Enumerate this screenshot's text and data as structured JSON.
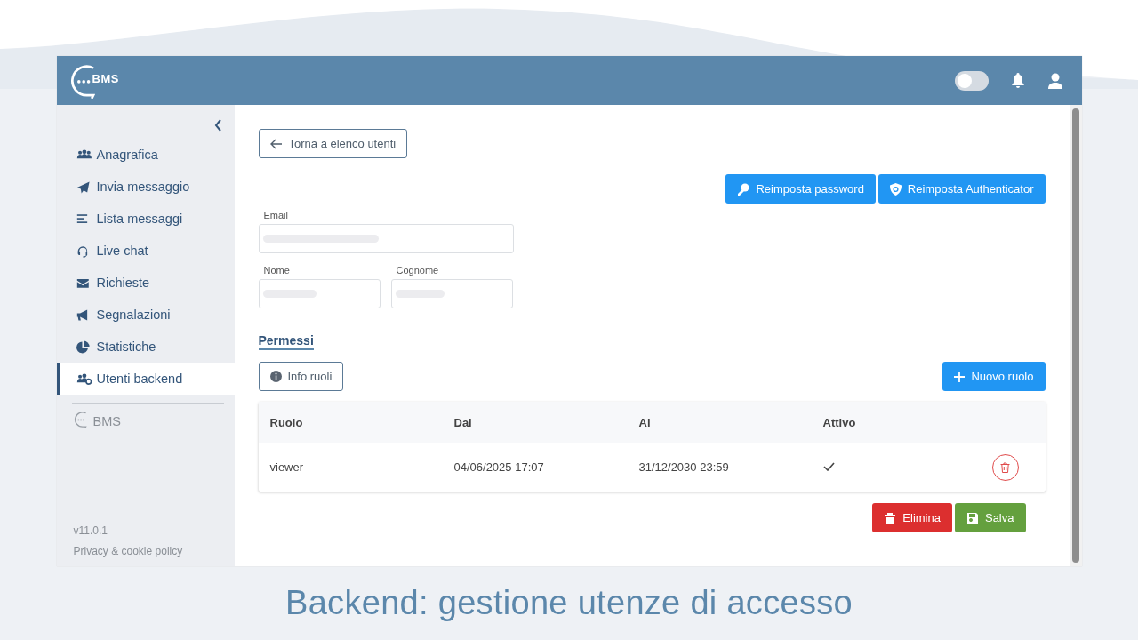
{
  "header": {
    "logo_text": "BMS",
    "dark_mode": {
      "on": false
    }
  },
  "sidebar": {
    "items": [
      {
        "label": "Anagrafica",
        "selected": false
      },
      {
        "label": "Invia messaggio",
        "selected": false
      },
      {
        "label": "Lista messaggi",
        "selected": false
      },
      {
        "label": "Live chat",
        "selected": false
      },
      {
        "label": "Richieste",
        "selected": false
      },
      {
        "label": "Segnalazioni",
        "selected": false
      },
      {
        "label": "Statistiche",
        "selected": false
      },
      {
        "label": "Utenti backend",
        "selected": true
      }
    ],
    "brand": "BMS",
    "version": "v11.0.1",
    "privacy_link": "Privacy & cookie policy"
  },
  "back_button": "Torna a elenco utenti",
  "actions": [
    "Reimposta password",
    "Reimposta Authenticator"
  ],
  "form": {
    "fields": [
      {
        "label": "Email"
      },
      {
        "label": "Nome"
      },
      {
        "label": "Cognome"
      }
    ]
  },
  "section_tab": "Permessi",
  "info_button": "Info ruoli",
  "new_role_button": "Nuovo ruolo",
  "table": {
    "columns": [
      "Ruolo",
      "Dal",
      "Al",
      "Attivo"
    ],
    "rows": [
      {
        "ruolo": "viewer",
        "dal": "04/06/2025 17:07",
        "al": "31/12/2030 23:59",
        "attivo": true
      }
    ]
  },
  "footer_buttons": [
    {
      "kind": "danger",
      "label": "Elimina"
    },
    {
      "kind": "success",
      "label": "Salva"
    }
  ],
  "caption": "Backend: gestione utenze di accesso"
}
